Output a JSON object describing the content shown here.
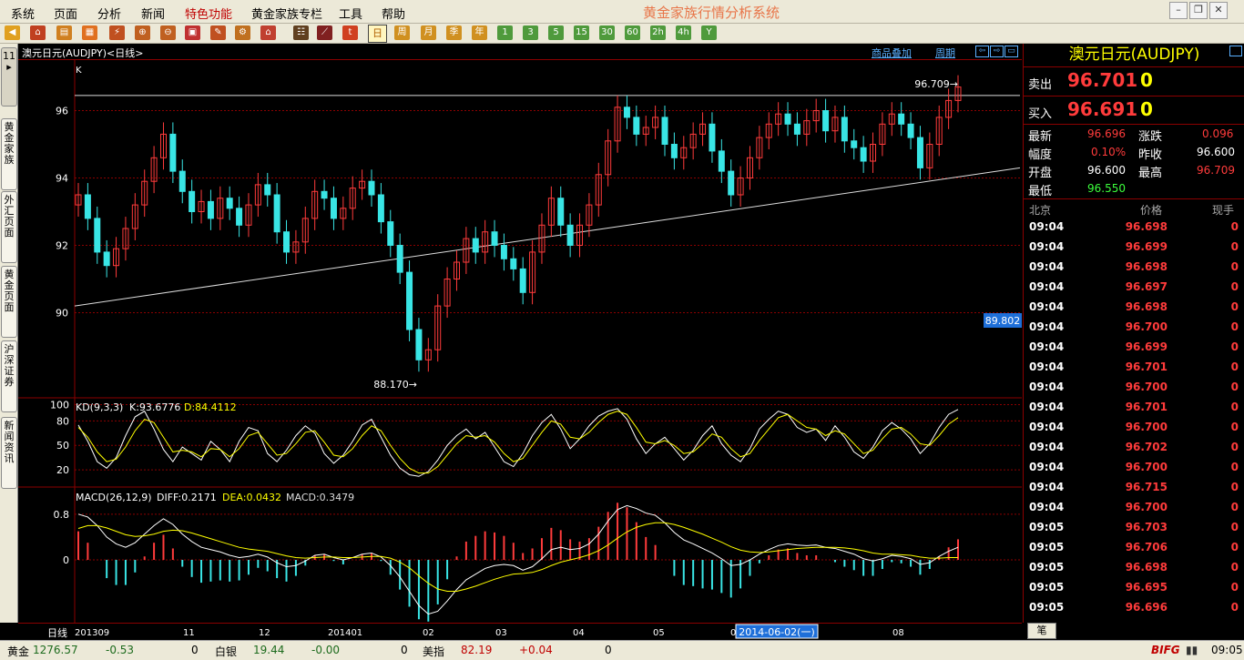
{
  "menu": [
    "系统",
    "页面",
    "分析",
    "新闻",
    "特色功能",
    "黄金家族专栏",
    "工具",
    "帮助"
  ],
  "menu_highlight": "特色功能",
  "app_title": "黄金家族行情分析系统",
  "toolbar": {
    "period_buttons": [
      "日",
      "周",
      "月",
      "季",
      "年",
      "1",
      "3",
      "5",
      "15",
      "30",
      "60",
      "2h",
      "4h",
      "Y"
    ],
    "selected_period": "日"
  },
  "side_tabs": [
    "11",
    "黄金家族",
    "外汇页面",
    "黄金页面",
    "沪深证券",
    "新闻资讯"
  ],
  "chart_header": {
    "title": "澳元日元(AUDJPY)<日线>",
    "link_overlay": "商品叠加",
    "link_period": "周期"
  },
  "chart_data": [
    {
      "type": "candlestick",
      "title": "",
      "panel_label": "K",
      "y_ticks": [
        96,
        94,
        92,
        90
      ],
      "ylim": [
        87.5,
        97.5
      ],
      "annotations": {
        "high": "96.709",
        "low": "88.170",
        "cursor_price": "89.802"
      },
      "x_labels": [
        "201309",
        "11",
        "12",
        "201401",
        "02",
        "03",
        "04",
        "05",
        "06",
        "08"
      ],
      "selected_date": "2014-06-02(一)",
      "trendline": {
        "from": [
          0,
          90.2
        ],
        "to": [
          1,
          94.3
        ]
      },
      "level_line": 96.45,
      "closes": [
        93.5,
        92.8,
        91.8,
        91.4,
        91.9,
        92.5,
        93.2,
        93.9,
        94.6,
        95.3,
        94.2,
        93.6,
        93.0,
        93.3,
        92.8,
        93.4,
        93.1,
        92.6,
        93.2,
        93.8,
        93.5,
        92.4,
        91.8,
        92.1,
        92.8,
        93.6,
        93.4,
        92.8,
        93.1,
        93.7,
        93.9,
        93.5,
        92.7,
        92.0,
        91.2,
        89.5,
        88.6,
        88.9,
        90.2,
        91.0,
        91.5,
        92.2,
        91.8,
        92.4,
        92.0,
        91.6,
        91.3,
        90.6,
        91.8,
        92.6,
        93.4,
        92.6,
        92.0,
        92.6,
        93.2,
        94.1,
        95.1,
        96.1,
        95.8,
        95.3,
        95.5,
        95.8,
        95.0,
        94.6,
        94.9,
        95.3,
        95.6,
        94.8,
        94.2,
        93.5,
        94.0,
        94.6,
        95.2,
        95.6,
        95.9,
        95.6,
        95.3,
        95.7,
        96.0,
        95.4,
        95.8,
        95.1,
        94.9,
        94.5,
        95.0,
        95.6,
        95.9,
        95.6,
        95.2,
        94.3,
        95.0,
        95.8,
        96.3,
        96.7
      ],
      "series_note": "daily candles, color by up/down"
    },
    {
      "type": "line",
      "panel_label": "KD(9,3,3)",
      "k_label": "K:93.6776",
      "d_label": "D:84.4112",
      "y_ticks": [
        100,
        80,
        50,
        20
      ],
      "ylim": [
        0,
        105
      ],
      "series": [
        {
          "name": "K",
          "values": [
            75,
            55,
            30,
            22,
            35,
            62,
            85,
            92,
            70,
            45,
            30,
            48,
            40,
            32,
            55,
            45,
            30,
            55,
            72,
            68,
            40,
            30,
            44,
            62,
            74,
            65,
            40,
            28,
            38,
            55,
            75,
            82,
            60,
            38,
            22,
            14,
            12,
            18,
            32,
            50,
            62,
            70,
            58,
            66,
            48,
            30,
            24,
            40,
            62,
            78,
            88,
            70,
            46,
            58,
            74,
            86,
            92,
            95,
            82,
            58,
            40,
            52,
            60,
            46,
            32,
            44,
            62,
            74,
            52,
            38,
            30,
            46,
            70,
            82,
            92,
            88,
            72,
            66,
            70,
            56,
            74,
            60,
            42,
            34,
            48,
            68,
            78,
            70,
            58,
            40,
            52,
            72,
            88,
            94
          ]
        },
        {
          "name": "D",
          "values": [
            72,
            60,
            42,
            30,
            33,
            48,
            68,
            82,
            78,
            60,
            42,
            44,
            42,
            36,
            46,
            45,
            36,
            46,
            62,
            66,
            52,
            38,
            40,
            52,
            66,
            68,
            54,
            38,
            36,
            46,
            62,
            74,
            68,
            50,
            34,
            22,
            16,
            16,
            24,
            38,
            52,
            62,
            60,
            62,
            54,
            40,
            30,
            34,
            50,
            66,
            80,
            76,
            60,
            58,
            66,
            78,
            88,
            92,
            88,
            72,
            54,
            52,
            56,
            50,
            40,
            42,
            52,
            64,
            60,
            46,
            36,
            40,
            56,
            70,
            84,
            88,
            80,
            72,
            70,
            62,
            68,
            64,
            52,
            40,
            44,
            58,
            70,
            72,
            64,
            52,
            50,
            62,
            76,
            84
          ]
        }
      ]
    },
    {
      "type": "bar",
      "panel_label": "MACD(26,12,9)",
      "diff_label": "DIFF:0.2171",
      "dea_label": "DEA:0.0432",
      "macd_label": "MACD:0.3479",
      "y_ticks": [
        0.8,
        0
      ],
      "ylim": [
        -1.1,
        1.1
      ],
      "series": [
        {
          "name": "DIFF",
          "values": [
            0.8,
            0.75,
            0.6,
            0.4,
            0.28,
            0.22,
            0.3,
            0.45,
            0.6,
            0.72,
            0.62,
            0.45,
            0.32,
            0.22,
            0.18,
            0.14,
            0.08,
            0.04,
            0.06,
            0.1,
            0.05,
            -0.05,
            -0.12,
            -0.1,
            -0.02,
            0.08,
            0.1,
            0.04,
            0.0,
            0.04,
            0.1,
            0.12,
            0.05,
            -0.1,
            -0.3,
            -0.55,
            -0.8,
            -0.95,
            -0.9,
            -0.72,
            -0.52,
            -0.35,
            -0.25,
            -0.15,
            -0.1,
            -0.08,
            -0.1,
            -0.18,
            -0.12,
            0.02,
            0.18,
            0.22,
            0.18,
            0.2,
            0.28,
            0.45,
            0.68,
            0.88,
            0.95,
            0.9,
            0.82,
            0.78,
            0.65,
            0.48,
            0.35,
            0.28,
            0.2,
            0.12,
            0.02,
            -0.1,
            -0.08,
            0.0,
            0.1,
            0.18,
            0.25,
            0.28,
            0.26,
            0.25,
            0.26,
            0.22,
            0.2,
            0.15,
            0.1,
            0.02,
            -0.02,
            0.02,
            0.08,
            0.06,
            0.02,
            -0.08,
            -0.05,
            0.06,
            0.15,
            0.22
          ]
        },
        {
          "name": "DEA",
          "values": [
            0.55,
            0.6,
            0.6,
            0.56,
            0.5,
            0.44,
            0.41,
            0.42,
            0.45,
            0.5,
            0.52,
            0.51,
            0.47,
            0.42,
            0.37,
            0.32,
            0.27,
            0.22,
            0.19,
            0.17,
            0.15,
            0.11,
            0.07,
            0.04,
            0.03,
            0.04,
            0.05,
            0.05,
            0.04,
            0.04,
            0.05,
            0.06,
            0.06,
            0.03,
            -0.04,
            -0.14,
            -0.28,
            -0.41,
            -0.51,
            -0.55,
            -0.55,
            -0.51,
            -0.46,
            -0.4,
            -0.34,
            -0.29,
            -0.25,
            -0.24,
            -0.22,
            -0.17,
            -0.1,
            -0.04,
            0.0,
            0.04,
            0.09,
            0.16,
            0.26,
            0.38,
            0.49,
            0.57,
            0.62,
            0.65,
            0.65,
            0.62,
            0.57,
            0.51,
            0.45,
            0.38,
            0.31,
            0.23,
            0.17,
            0.14,
            0.13,
            0.14,
            0.16,
            0.18,
            0.2,
            0.21,
            0.22,
            0.22,
            0.22,
            0.21,
            0.19,
            0.16,
            0.12,
            0.1,
            0.1,
            0.09,
            0.08,
            0.05,
            0.03,
            0.03,
            0.04,
            0.04
          ]
        }
      ]
    }
  ],
  "quote": {
    "header": "澳元日元(AUDJPY)",
    "sell_label": "卖出",
    "sell_value": "96.701",
    "sell_vol": "0",
    "buy_label": "买入",
    "buy_value": "96.691",
    "buy_vol": "0",
    "latest_label": "最新",
    "latest": "96.696",
    "change_label": "涨跌",
    "change": "0.096",
    "amp_label": "幅度",
    "amp": "0.10%",
    "prevclose_label": "昨收",
    "prevclose": "96.600",
    "open_label": "开盘",
    "open": "96.600",
    "high_label": "最高",
    "high": "96.709",
    "low_label": "最低",
    "low": "96.550"
  },
  "ticks_header": {
    "time": "北京",
    "price": "价格",
    "vol": "现手"
  },
  "ticks": [
    [
      "09:04",
      "96.698",
      "0"
    ],
    [
      "09:04",
      "96.699",
      "0"
    ],
    [
      "09:04",
      "96.698",
      "0"
    ],
    [
      "09:04",
      "96.697",
      "0"
    ],
    [
      "09:04",
      "96.698",
      "0"
    ],
    [
      "09:04",
      "96.700",
      "0"
    ],
    [
      "09:04",
      "96.699",
      "0"
    ],
    [
      "09:04",
      "96.701",
      "0"
    ],
    [
      "09:04",
      "96.700",
      "0"
    ],
    [
      "09:04",
      "96.701",
      "0"
    ],
    [
      "09:04",
      "96.700",
      "0"
    ],
    [
      "09:04",
      "96.702",
      "0"
    ],
    [
      "09:04",
      "96.700",
      "0"
    ],
    [
      "09:04",
      "96.715",
      "0"
    ],
    [
      "09:04",
      "96.700",
      "0"
    ],
    [
      "09:05",
      "96.703",
      "0"
    ],
    [
      "09:05",
      "96.706",
      "0"
    ],
    [
      "09:05",
      "96.698",
      "0"
    ],
    [
      "09:05",
      "96.695",
      "0"
    ],
    [
      "09:05",
      "96.696",
      "0"
    ]
  ],
  "bottom_tab": "笔",
  "time_axis_label": "日线",
  "status": {
    "gold_label": "黄金",
    "gold_val": "1276.57",
    "gold_chg": "-0.53",
    "gold_n": "0",
    "silver_label": "白银",
    "silver_val": "19.44",
    "silver_chg": "-0.00",
    "silver_n": "0",
    "usd_label": "美指",
    "usd_val": "82.19",
    "usd_chg": "+0.04",
    "usd_n": "0",
    "logo": "BIFG",
    "clock": "09:05"
  }
}
